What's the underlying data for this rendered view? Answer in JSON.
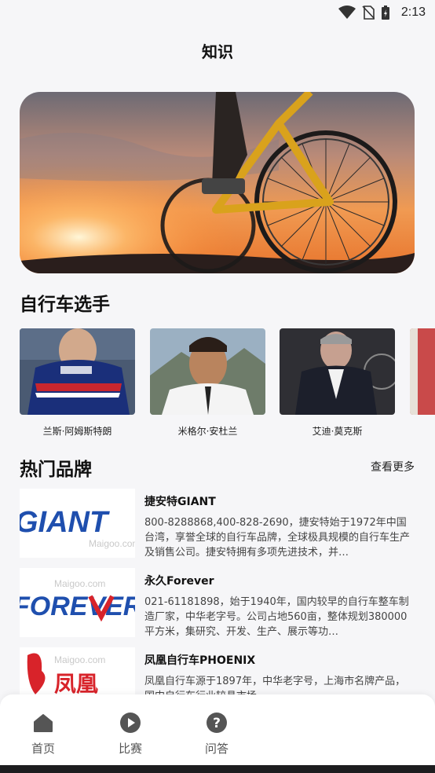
{
  "status": {
    "time": "2:13"
  },
  "header": {
    "title": "知识"
  },
  "riders_section": {
    "title": "自行车选手",
    "items": [
      {
        "name": "兰斯·阿姆斯特朗"
      },
      {
        "name": "米格尔·安杜兰"
      },
      {
        "name": "艾迪·莫克斯"
      }
    ]
  },
  "brands_section": {
    "title": "热门品牌",
    "more_label": "查看更多",
    "items": [
      {
        "name": "捷安特GIANT",
        "desc": "800-8288868,400-828-2690，捷安特始于1972年中国台湾，享誉全球的自行车品牌，全球极具规模的自行车生产及销售公司。捷安特拥有多项先进技术，并…",
        "logo_text": "GIANT",
        "logo_sub": "Maigoo.com"
      },
      {
        "name": "永久Forever",
        "desc": "021-61181898，始于1940年，国内较早的自行车整车制造厂家，中华老字号。公司占地560亩，整体规划380000平方米，集研究、开发、生产、展示等功…",
        "logo_text": "FOREVER",
        "logo_sub": "Maigoo.com"
      },
      {
        "name": "凤凰自行车PHOENIX",
        "desc": "凤凰自行车源于1897年，中华老字号，上海市名牌产品，国内自行车行业较具市场…",
        "logo_text": "凤凰",
        "logo_sub": "Maigoo.com"
      }
    ]
  },
  "tabbar": {
    "items": [
      {
        "label": "首页",
        "icon": "home-icon"
      },
      {
        "label": "比赛",
        "icon": "play-icon"
      },
      {
        "label": "问答",
        "icon": "question-icon"
      }
    ]
  },
  "colors": {
    "accent": "#1a6fd8",
    "giant_blue": "#1f4fae",
    "forever_red": "#d8232a",
    "tab_icon": "#555555"
  }
}
